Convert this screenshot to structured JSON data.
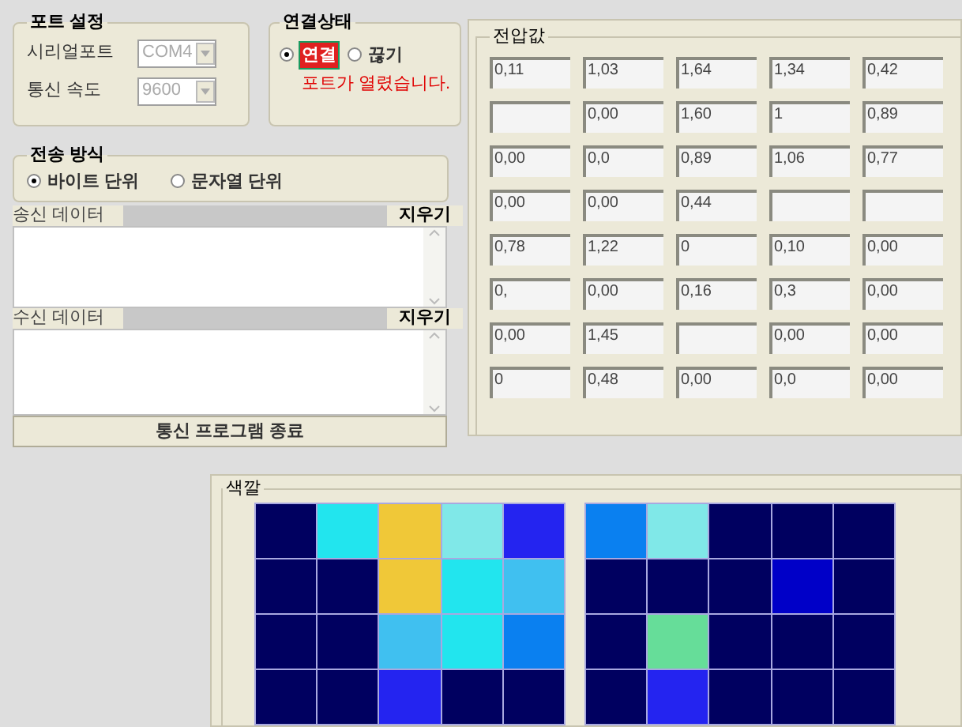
{
  "port_settings": {
    "title": "포트 설정",
    "fields": [
      {
        "label": "시리얼포트",
        "value": "COM4",
        "disabled": true
      },
      {
        "label": "통신 속도",
        "value": "9600",
        "disabled": true
      }
    ]
  },
  "connection": {
    "title": "연결상태",
    "options": [
      {
        "label": "연결",
        "selected": true
      },
      {
        "label": "끊기",
        "selected": false
      }
    ],
    "message": "포트가 열렸습니다."
  },
  "transfer_mode": {
    "title": "전송 방식",
    "options": [
      {
        "label": "바이트 단위",
        "selected": true
      },
      {
        "label": "문자열 단위",
        "selected": false
      }
    ]
  },
  "send": {
    "label": "송신 데이터",
    "clear_button": "지우기"
  },
  "receive": {
    "label": "수신 데이터",
    "clear_button": "지우기"
  },
  "exit_button": "통신 프로그램 종료",
  "voltages": {
    "title": "전압값",
    "rows": [
      [
        {
          "value": "0,11"
        },
        {
          "value": "1,03"
        },
        {
          "value": "1,64"
        },
        {
          "value": "1,34"
        },
        {
          "value": "0,42"
        }
      ],
      [
        {},
        {
          "value": "0,00"
        },
        {
          "value": "1,60"
        },
        {
          "value": "1"
        },
        {
          "value": "0,89"
        }
      ],
      [
        {
          "value": "0,00"
        },
        {
          "value": "0,0"
        },
        {
          "value": "0,89"
        },
        {
          "value": "1,06"
        },
        {
          "value": "0,77"
        }
      ],
      [
        {
          "value": "0,00"
        },
        {
          "value": "0,00"
        },
        {
          "value": "0,44"
        },
        {},
        {}
      ],
      [
        {
          "value": "0,78"
        },
        {
          "value": "1,22"
        },
        {
          "value": "0"
        },
        {
          "value": "0,10"
        },
        {
          "value": "0,00"
        }
      ],
      [
        {
          "value": "0,"
        },
        {
          "value": "0,00"
        },
        {
          "value": "0,16"
        },
        {
          "value": "0,3"
        },
        {
          "value": "0,00"
        }
      ],
      [
        {
          "value": "0,00"
        },
        {
          "value": "1,45"
        },
        {},
        {
          "value": "0,00"
        },
        {
          "value": "0,00"
        }
      ],
      [
        {
          "value": "0"
        },
        {
          "value": "0,48"
        },
        {
          "value": "0,00"
        },
        {
          "value": "0,0"
        },
        {
          "value": "0,00"
        }
      ]
    ]
  },
  "colors": {
    "title": "색깔",
    "grids": [
      {
        "rows": [
          [
            {
              "color": "#000060"
            },
            {
              "color": "#22e5ee"
            },
            {
              "color": "#f0c838"
            },
            {
              "color": "#80e8e8"
            },
            {
              "color": "#2424f0"
            }
          ],
          [
            {
              "color": "#000060"
            },
            {
              "color": "#000060"
            },
            {
              "color": "#f0c838"
            },
            {
              "color": "#22e5ee"
            },
            {
              "color": "#40c0f0"
            }
          ],
          [
            {
              "color": "#000060"
            },
            {
              "color": "#000060"
            },
            {
              "color": "#40c0f0"
            },
            {
              "color": "#22e5ee"
            },
            {
              "color": "#0a80f0"
            }
          ],
          [
            {
              "color": "#000060"
            },
            {
              "color": "#000060"
            },
            {
              "color": "#2424f0"
            },
            {
              "color": "#000060"
            },
            {
              "color": "#000060"
            }
          ]
        ]
      },
      {
        "rows": [
          [
            {
              "color": "#0a80f0"
            },
            {
              "color": "#80e8e8"
            },
            {
              "color": "#000060"
            },
            {
              "color": "#000060"
            },
            {
              "color": "#000060"
            }
          ],
          [
            {
              "color": "#000060"
            },
            {
              "color": "#000060"
            },
            {
              "color": "#000060"
            },
            {
              "color": "#0000c8"
            },
            {
              "color": "#000060"
            }
          ],
          [
            {
              "color": "#000060"
            },
            {
              "color": "#66dd99"
            },
            {
              "color": "#000060"
            },
            {
              "color": "#000060"
            },
            {
              "color": "#000060"
            }
          ],
          [
            {
              "color": "#000060"
            },
            {
              "color": "#2424f0"
            },
            {
              "color": "#000060"
            },
            {
              "color": "#000060"
            },
            {
              "color": "#000060"
            }
          ]
        ]
      }
    ]
  }
}
